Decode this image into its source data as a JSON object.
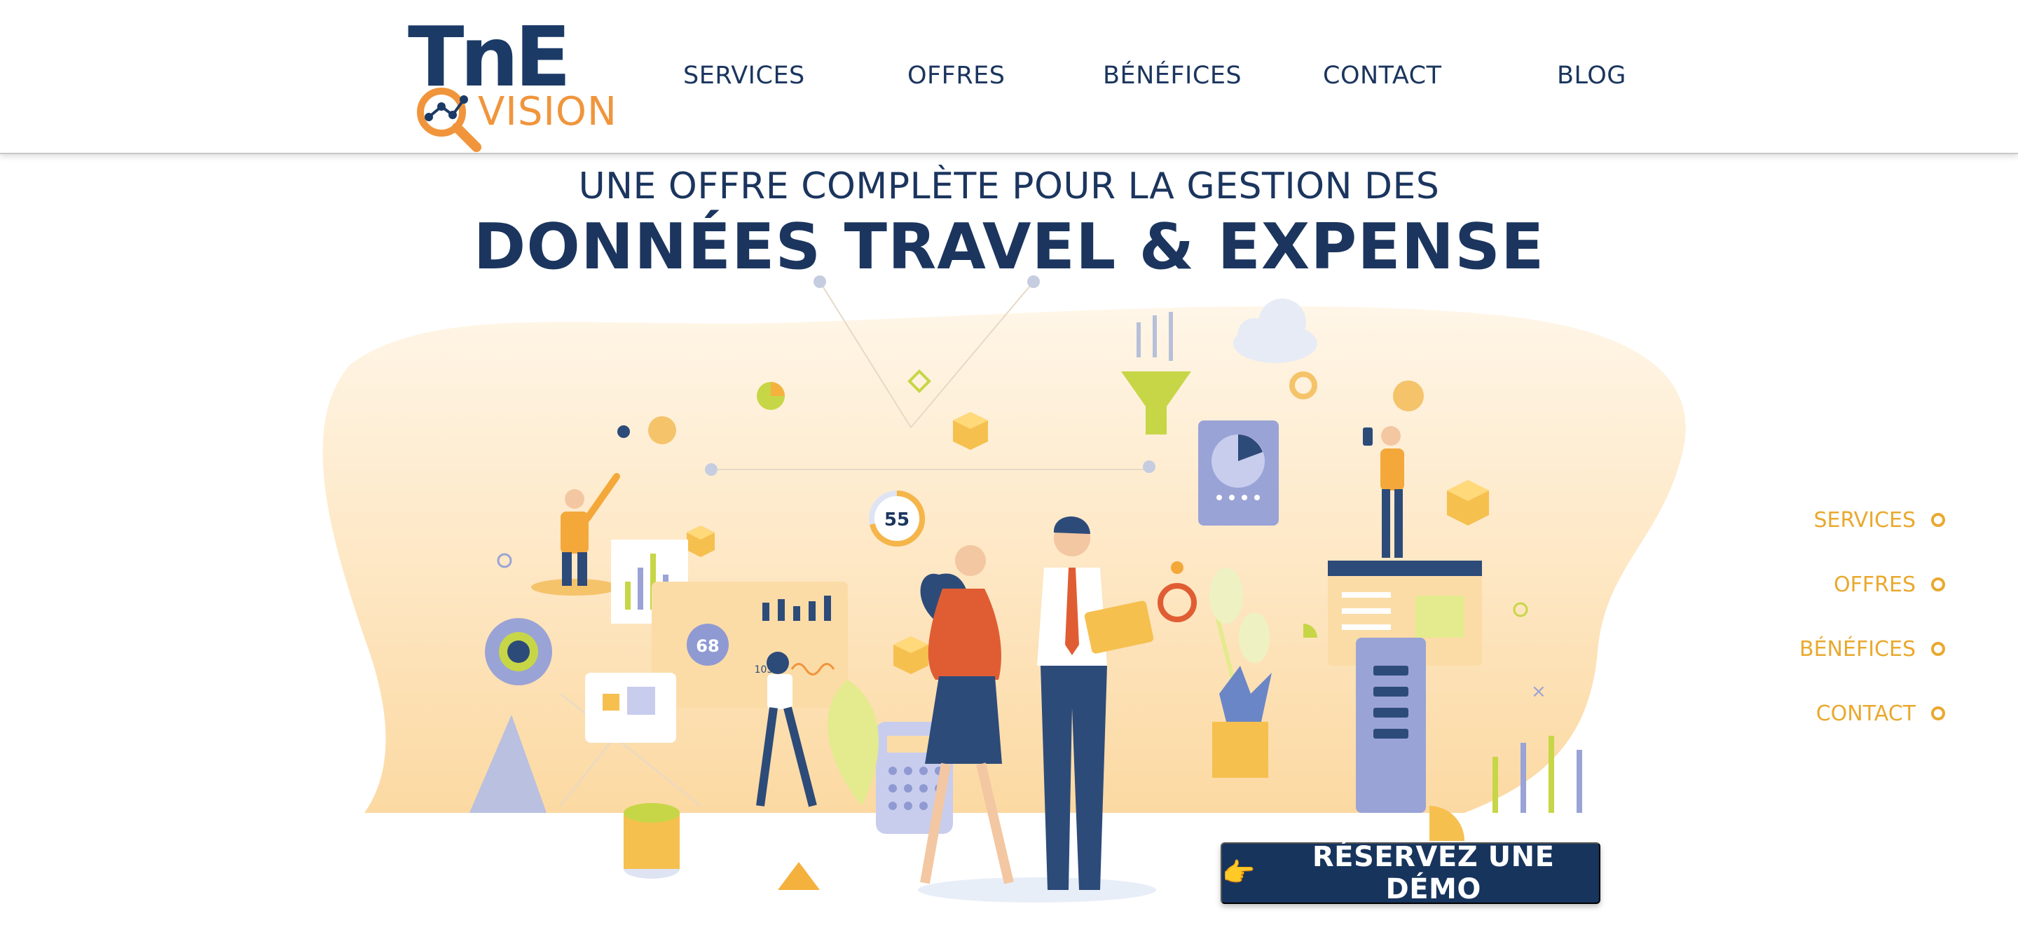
{
  "logo": {
    "main_text": "TnE",
    "sub_text": "VISION"
  },
  "nav": {
    "items": [
      {
        "label": "SERVICES"
      },
      {
        "label": "OFFRES"
      },
      {
        "label": "BÉNÉFICES"
      },
      {
        "label": "CONTACT"
      },
      {
        "label": "BLOG"
      }
    ]
  },
  "hero": {
    "subtitle": "UNE OFFRE COMPLÈTE POUR LA GESTION DES",
    "title": "DONNÉES TRAVEL & EXPENSE"
  },
  "illustration": {
    "gauge_values": [
      "55",
      "68"
    ],
    "small_label": "105"
  },
  "side_nav": {
    "items": [
      {
        "label": "SERVICES"
      },
      {
        "label": "OFFRES"
      },
      {
        "label": "BÉNÉFICES"
      },
      {
        "label": "CONTACT"
      }
    ]
  },
  "cta": {
    "icon": "pointing-hand-icon",
    "glyph": "👉",
    "label": "RÉSERVEZ UNE DÉMO"
  },
  "colors": {
    "navy": "#1b355e",
    "orange": "#f0953c",
    "gold": "#e9a92f",
    "cta_bg": "#17345d",
    "blob": "#fde7c4"
  }
}
